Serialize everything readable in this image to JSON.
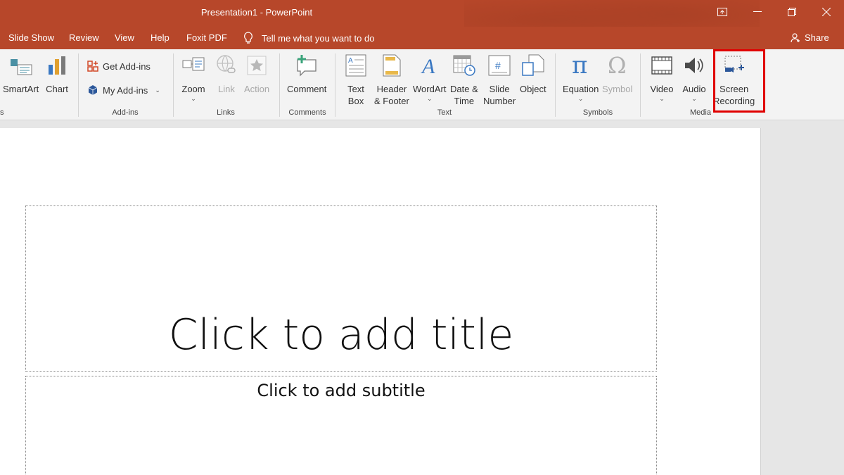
{
  "window": {
    "title": "Presentation1  -  PowerPoint",
    "colors": {
      "accent": "#b7472a",
      "highlight": "#e00000"
    }
  },
  "tabs": [
    "Slide Show",
    "Review",
    "View",
    "Help",
    "Foxit PDF"
  ],
  "tell_me": "Tell me what you want to do",
  "share": "Share",
  "ribbon": {
    "illustrations": {
      "smartart": "SmartArt",
      "chart": "Chart",
      "group_label_fragment": "s"
    },
    "addins": {
      "get": "Get Add-ins",
      "my": "My Add-ins",
      "group_label": "Add-ins"
    },
    "links": {
      "zoom": "Zoom",
      "link": "Link",
      "action": "Action",
      "group_label": "Links"
    },
    "comments": {
      "comment": "Comment",
      "group_label": "Comments"
    },
    "text": {
      "textbox_1": "Text",
      "textbox_2": "Box",
      "header_1": "Header",
      "header_2": "& Footer",
      "wordart": "WordArt",
      "datetime_1": "Date &",
      "datetime_2": "Time",
      "slidenum_1": "Slide",
      "slidenum_2": "Number",
      "object": "Object",
      "group_label": "Text"
    },
    "symbols": {
      "equation": "Equation",
      "symbol": "Symbol",
      "group_label": "Symbols"
    },
    "media": {
      "video": "Video",
      "audio": "Audio",
      "screen_1": "Screen",
      "screen_2": "Recording",
      "group_label": "Media"
    }
  },
  "slide": {
    "title_placeholder": "Click to add title",
    "subtitle_placeholder": "Click to add subtitle"
  }
}
